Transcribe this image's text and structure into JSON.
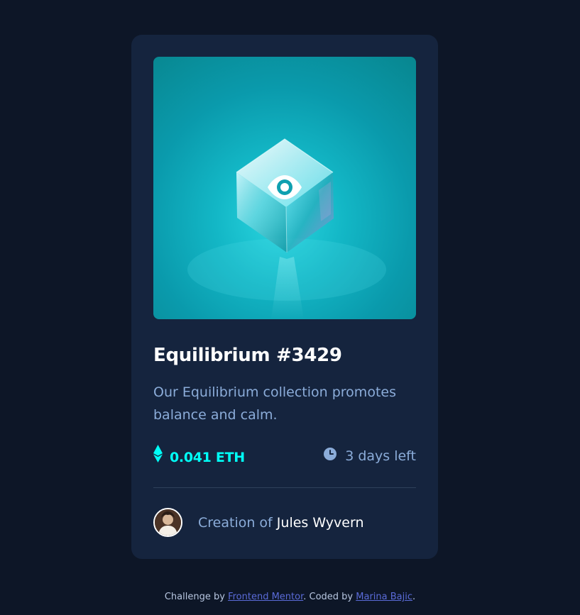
{
  "card": {
    "title": "Equilibrium #3429",
    "description": "Our Equilibrium collection promotes balance and calm.",
    "price": "0.041 ETH",
    "time_left": "3 days left",
    "creator_prefix": "Creation of",
    "creator_name": "Jules Wyvern",
    "overlay_icon": "eye-icon"
  },
  "attribution": {
    "prefix": "Challenge by",
    "link1": "Frontend Mentor",
    "middle": ". Coded by",
    "link2": "Marina Bajic",
    "suffix": "."
  },
  "colors": {
    "page_bg": "#0d1627",
    "card_bg": "#15243e",
    "accent_cyan": "#00fff7",
    "soft_blue": "#8bacd9",
    "white": "#ffffff",
    "link": "#5a6bd8"
  }
}
